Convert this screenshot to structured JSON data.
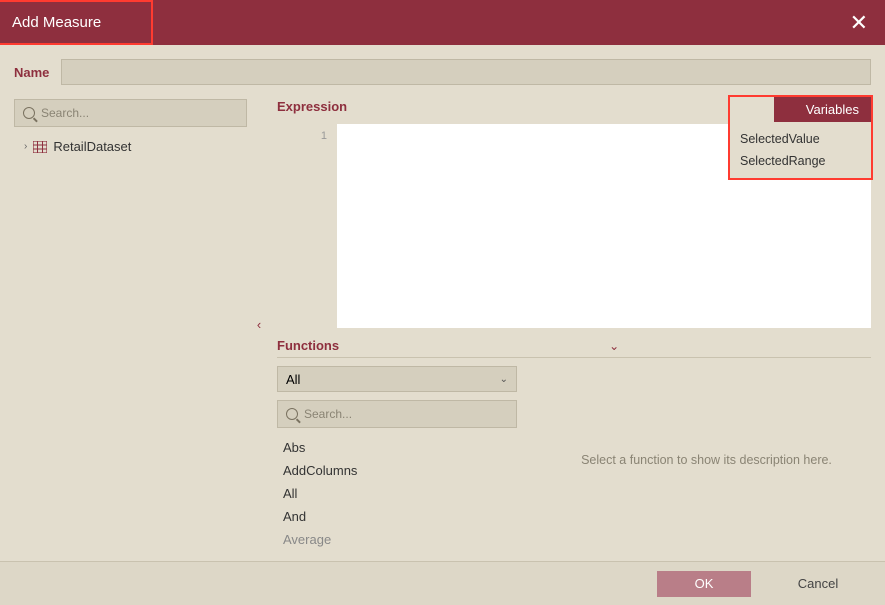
{
  "dialog": {
    "title": "Add Measure",
    "close_icon": "✕"
  },
  "name_field": {
    "label": "Name",
    "value": ""
  },
  "tree": {
    "search_placeholder": "Search...",
    "items": [
      {
        "label": "RetailDataset"
      }
    ]
  },
  "expression": {
    "label": "Expression",
    "line_number": "1"
  },
  "variables": {
    "tab_label": "Variables",
    "items": [
      "SelectedValue",
      "SelectedRange"
    ]
  },
  "functions": {
    "label": "Functions",
    "filter_selected": "All",
    "search_placeholder": "Search...",
    "list": [
      "Abs",
      "AddColumns",
      "All",
      "And",
      "Average"
    ],
    "description_placeholder": "Select a function to show its description here."
  },
  "footer": {
    "ok_label": "OK",
    "cancel_label": "Cancel"
  }
}
